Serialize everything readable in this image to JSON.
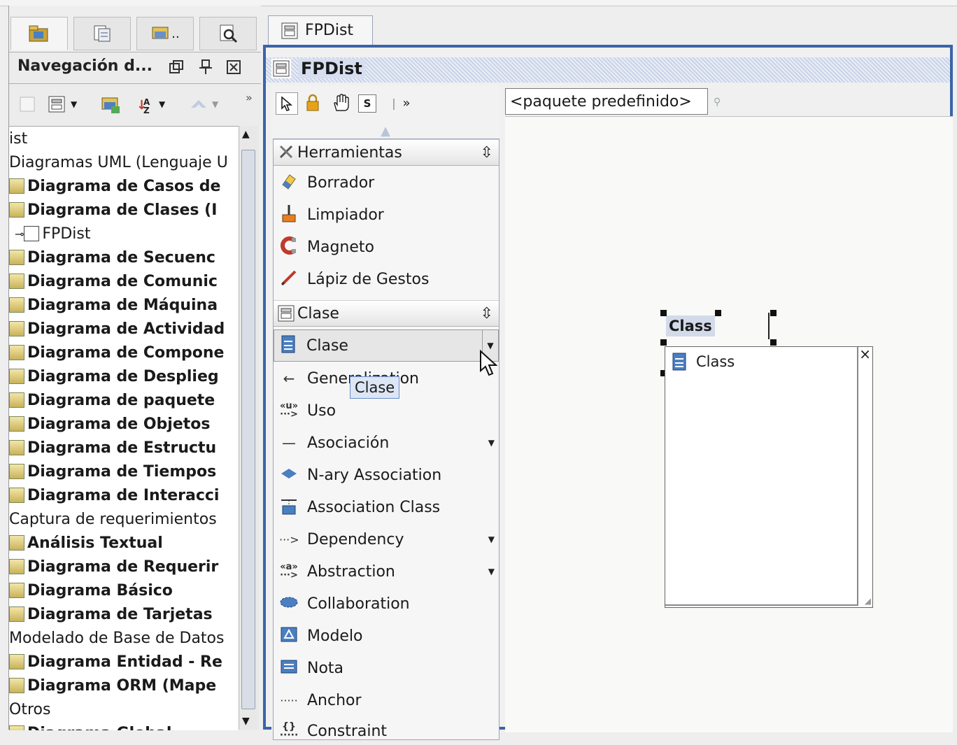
{
  "left_panel": {
    "title": "Navegación d...",
    "tree": [
      {
        "label": "ist",
        "bold": false
      },
      {
        "label": "Diagramas UML (Lenguaje U",
        "bold": false
      },
      {
        "label": "Diagrama de Casos de",
        "bold": true
      },
      {
        "label": "Diagrama de Clases (I",
        "bold": true
      },
      {
        "label": "FPDist",
        "bold": false
      },
      {
        "label": "Diagrama de Secuenc",
        "bold": true
      },
      {
        "label": "Diagrama de Comunic",
        "bold": true
      },
      {
        "label": "Diagrama de Máquina",
        "bold": true
      },
      {
        "label": "Diagrama de Actividad",
        "bold": true
      },
      {
        "label": "Diagrama de Compone",
        "bold": true
      },
      {
        "label": "Diagrama de Desplieg",
        "bold": true
      },
      {
        "label": "Diagrama de paquete",
        "bold": true
      },
      {
        "label": "Diagrama de Objetos",
        "bold": true
      },
      {
        "label": "Diagrama de Estructu",
        "bold": true
      },
      {
        "label": "Diagrama de Tiempos",
        "bold": true
      },
      {
        "label": "Diagrama de Interacci",
        "bold": true
      },
      {
        "label": "Captura de requerimientos",
        "bold": false
      },
      {
        "label": "Análisis Textual",
        "bold": true
      },
      {
        "label": "Diagrama de Requerir",
        "bold": true
      },
      {
        "label": "Diagrama Básico",
        "bold": true
      },
      {
        "label": "Diagrama de Tarjetas",
        "bold": true
      },
      {
        "label": "Modelado de Base de Datos",
        "bold": false
      },
      {
        "label": "Diagrama Entidad - Re",
        "bold": true
      },
      {
        "label": "Diagrama ORM (Mape",
        "bold": true
      },
      {
        "label": "Otros",
        "bold": false
      },
      {
        "label": "Diagrama Global",
        "bold": true
      }
    ]
  },
  "document": {
    "tab_label": "FPDist",
    "title": "FPDist",
    "package_field": "<paquete predefinido>"
  },
  "palette": {
    "categories": {
      "tools": "Herramientas",
      "class": "Clase"
    },
    "tools_items": [
      "Borrador",
      "Limpiador",
      "Magneto",
      "Lápiz de Gestos"
    ],
    "class_items": [
      "Clase",
      "Generalization",
      "Uso",
      "Asociación",
      "N-ary Association",
      "Association Class",
      "Dependency",
      "Abstraction",
      "Collaboration",
      "Modelo",
      "Nota",
      "Anchor",
      "Constraint"
    ],
    "tooltip": "Clase",
    "toolbar_s": "S"
  },
  "canvas": {
    "class_name": "Class",
    "popup_item": "Class",
    "close_glyph": "×"
  },
  "colors": {
    "accent_border": "#3b64a8",
    "selection_bg": "#d6def0"
  }
}
